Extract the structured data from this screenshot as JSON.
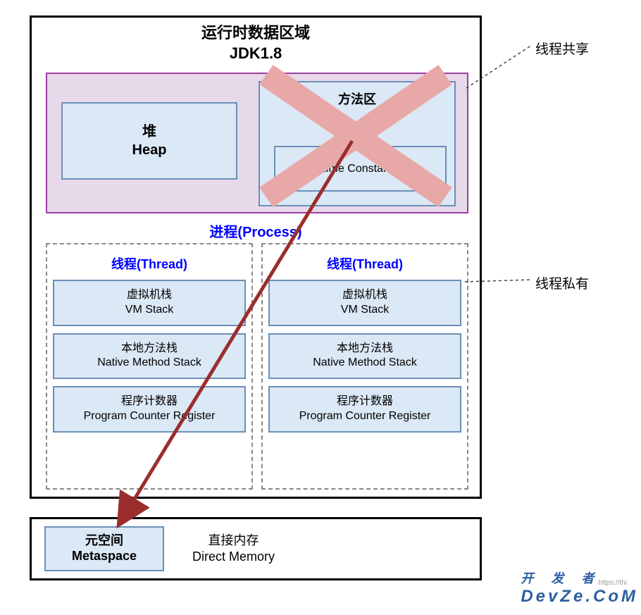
{
  "title_cn": "运行时数据区域",
  "title_en": "JDK1.8",
  "shared_annotation": "线程共享",
  "private_annotation": "线程私有",
  "heap_cn": "堆",
  "heap_en": "Heap",
  "method_cn": "方法区",
  "rcp_en": "Runtime Constant Pool",
  "process_label": "进程(Process)",
  "thread_label": "线程(Thread)",
  "vm_stack_cn": "虚拟机栈",
  "vm_stack_en": "VM Stack",
  "native_stack_cn": "本地方法栈",
  "native_stack_en": "Native Method Stack",
  "pc_cn": "程序计数器",
  "pc_en": "Program Counter Register",
  "metaspace_cn": "元空间",
  "metaspace_en": "Metaspace",
  "direct_cn": "直接内存",
  "direct_en": "Direct Memory",
  "watermark": "DevZe.CoM",
  "watermark2": "https://thi",
  "wm3": "开 发 者"
}
